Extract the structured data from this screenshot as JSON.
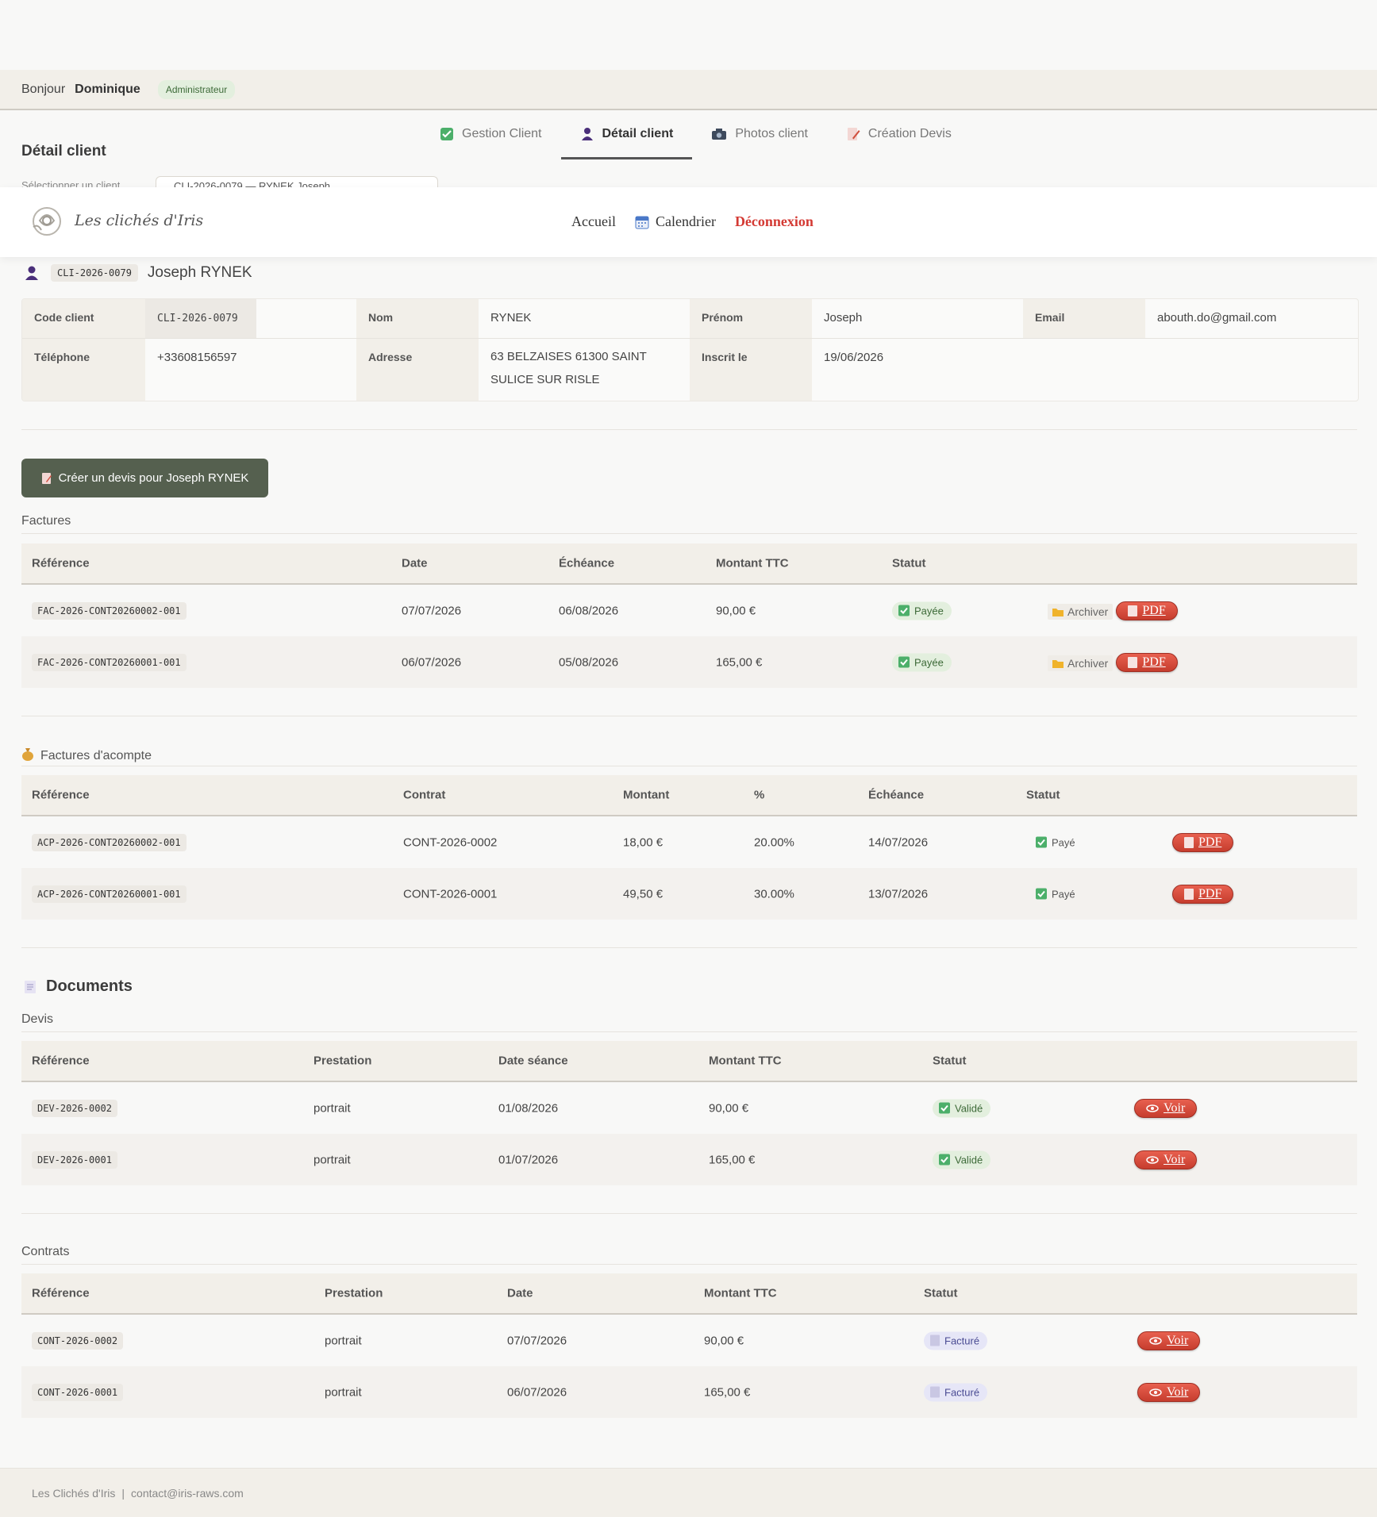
{
  "user": {
    "greeting": "Bonjour",
    "name": "Dominique",
    "role": "Administrateur"
  },
  "page": {
    "title": "Détail client"
  },
  "tabs": [
    {
      "label": "Gestion Client",
      "icon": "check-box-icon"
    },
    {
      "label": "Détail client",
      "icon": "user-icon",
      "active": true
    },
    {
      "label": "Photos client",
      "icon": "camera-icon"
    },
    {
      "label": "Création Devis",
      "icon": "document-pen-icon"
    }
  ],
  "select_clipped": {
    "label": "Sélectionner un client",
    "value": "CLI-2026-0079 — RYNEK Joseph"
  },
  "navbar": {
    "brand": "Les clichés d'Iris",
    "links": {
      "home": "Accueil",
      "calendar": "Calendrier",
      "logout": "Déconnexion"
    }
  },
  "client": {
    "code": "CLI-2026-0079",
    "full_name": "Joseph RYNEK",
    "fields": {
      "code_label": "Code client",
      "code_value": "CLI-2026-0079",
      "nom_label": "Nom",
      "nom_value": "RYNEK",
      "prenom_label": "Prénom",
      "prenom_value": "Joseph",
      "email_label": "Email",
      "email_value": "abouth.do@gmail.com",
      "tel_label": "Téléphone",
      "tel_value": "+33608156597",
      "adresse_label": "Adresse",
      "adresse_line1": "63 BELZAISES 61300 SAINT",
      "adresse_line2": "SULICE SUR RISLE",
      "inscrit_label": "Inscrit le",
      "inscrit_value": "19/06/2026"
    }
  },
  "create_quote_button": "Créer un devis pour Joseph RYNEK",
  "invoices": {
    "title": "Factures",
    "headers": [
      "Référence",
      "Date",
      "Échéance",
      "Montant TTC",
      "Statut"
    ],
    "rows": [
      {
        "ref": "FAC-2026-CONT20260002-001",
        "date": "07/07/2026",
        "due": "06/08/2026",
        "amount": "90,00 €",
        "status": "Payée"
      },
      {
        "ref": "FAC-2026-CONT20260001-001",
        "date": "06/07/2026",
        "due": "05/08/2026",
        "amount": "165,00 €",
        "status": "Payée"
      }
    ],
    "archive_label": "Archiver",
    "pdf_label": "PDF"
  },
  "deposits": {
    "title": "Factures d'acompte",
    "headers": [
      "Référence",
      "Contrat",
      "Montant",
      "%",
      "Échéance",
      "Statut"
    ],
    "rows": [
      {
        "ref": "ACP-2026-CONT20260002-001",
        "contract": "CONT-2026-0002",
        "amount": "18,00 €",
        "pct": "20.00%",
        "due": "14/07/2026",
        "status": "Payé"
      },
      {
        "ref": "ACP-2026-CONT20260001-001",
        "contract": "CONT-2026-0001",
        "amount": "49,50 €",
        "pct": "30.00%",
        "due": "13/07/2026",
        "status": "Payé"
      }
    ],
    "pdf_label": "PDF"
  },
  "documents": {
    "title": "Documents",
    "quotes": {
      "title": "Devis",
      "headers": [
        "Référence",
        "Prestation",
        "Date séance",
        "Montant TTC",
        "Statut"
      ],
      "rows": [
        {
          "ref": "DEV-2026-0002",
          "service": "portrait",
          "date": "01/08/2026",
          "amount": "90,00 €",
          "status": "Validé"
        },
        {
          "ref": "DEV-2026-0001",
          "service": "portrait",
          "date": "01/07/2026",
          "amount": "165,00 €",
          "status": "Validé"
        }
      ],
      "view_label": "Voir"
    },
    "contracts": {
      "title": "Contrats",
      "headers": [
        "Référence",
        "Prestation",
        "Date",
        "Montant TTC",
        "Statut"
      ],
      "rows": [
        {
          "ref": "CONT-2026-0002",
          "service": "portrait",
          "date": "07/07/2026",
          "amount": "90,00 €",
          "status": "Facturé"
        },
        {
          "ref": "CONT-2026-0001",
          "service": "portrait",
          "date": "06/07/2026",
          "amount": "165,00 €",
          "status": "Facturé"
        }
      ],
      "view_label": "Voir"
    }
  },
  "footer": {
    "company": "Les Clichés d'Iris",
    "separator": "|",
    "email": "contact@iris-raws.com"
  },
  "colors": {
    "accent_green": "#55604f",
    "danger_red": "#d43a34",
    "paid_bg": "#e3efde"
  }
}
